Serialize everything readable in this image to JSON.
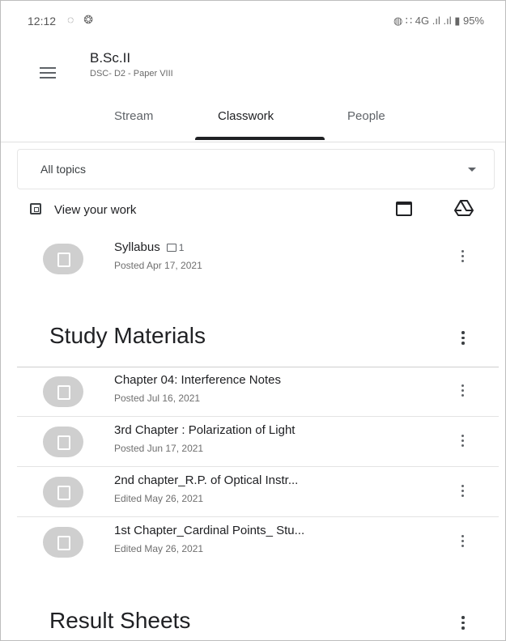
{
  "status_bar": {
    "time": "12:12",
    "left_icons": "◌ ❂",
    "right_text": "◍ ∷ 4G .ıl .ıl ▮ 95%"
  },
  "header": {
    "title": "B.Sc.II",
    "subtitle": "DSC- D2 - Paper VIII"
  },
  "tabs": [
    {
      "label": "Stream",
      "active": false
    },
    {
      "label": "Classwork",
      "active": true
    },
    {
      "label": "People",
      "active": false
    }
  ],
  "topic_filter": {
    "selected": "All topics"
  },
  "view_work": {
    "label": "View your work"
  },
  "top_items": [
    {
      "title": "Syllabus",
      "comment_count": "1",
      "meta": "Posted Apr 17, 2021"
    }
  ],
  "sections": [
    {
      "title": "Study Materials",
      "items": [
        {
          "title": "Chapter 04: Interference Notes",
          "meta": "Posted Jul 16, 2021"
        },
        {
          "title": "3rd Chapter : Polarization of Light",
          "meta": "Posted Jun 17, 2021"
        },
        {
          "title": "2nd chapter_R.P. of Optical Instr...",
          "meta": "Edited May 26, 2021"
        },
        {
          "title": "1st Chapter_Cardinal Points_ Stu...",
          "meta": "Edited May 26, 2021"
        }
      ]
    },
    {
      "title": "Result Sheets",
      "items": []
    }
  ],
  "icons": {
    "menu": "menu-icon",
    "calendar": "calendar-icon",
    "drive": "drive-icon",
    "assignment": "assignment-icon",
    "more": "more-vert-icon"
  },
  "colors": {
    "text_primary": "#202124",
    "text_secondary": "#6f6f6f",
    "avatar_bg": "#cfcfcf",
    "tab_indicator": "#202124"
  }
}
